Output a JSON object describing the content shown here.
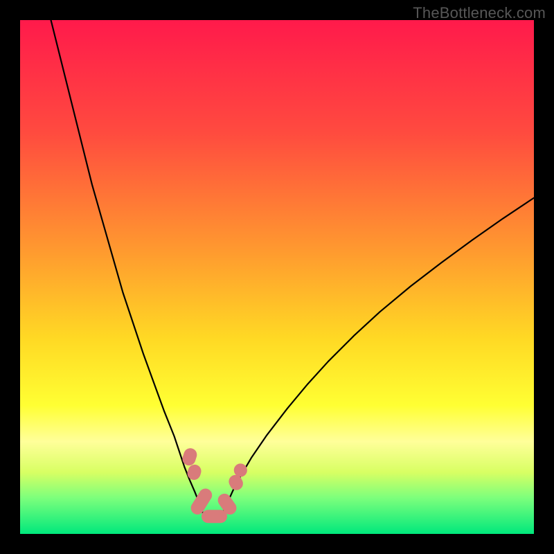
{
  "watermark": "TheBottleneck.com",
  "chart_data": {
    "type": "line",
    "title": "",
    "xlabel": "",
    "ylabel": "",
    "xlim": [
      0,
      100
    ],
    "ylim": [
      0,
      100
    ],
    "gradient_stops": [
      {
        "offset": 0,
        "color": "#ff1a4b"
      },
      {
        "offset": 0.22,
        "color": "#ff4b3f"
      },
      {
        "offset": 0.45,
        "color": "#ff9a2f"
      },
      {
        "offset": 0.62,
        "color": "#ffd924"
      },
      {
        "offset": 0.75,
        "color": "#ffff33"
      },
      {
        "offset": 0.82,
        "color": "#ffff9a"
      },
      {
        "offset": 0.88,
        "color": "#d8ff63"
      },
      {
        "offset": 0.93,
        "color": "#7cff7c"
      },
      {
        "offset": 1.0,
        "color": "#00e87c"
      }
    ],
    "series": [
      {
        "name": "left-curve",
        "x": [
          6,
          8,
          10,
          12,
          14,
          16,
          18,
          20,
          22,
          24,
          26,
          28,
          30,
          31,
          32,
          33,
          34,
          34.8
        ],
        "values": [
          100,
          92,
          84,
          76,
          68,
          61,
          54,
          47,
          41,
          35,
          29.5,
          24,
          19,
          16,
          13,
          10.5,
          8.2,
          6.2
        ]
      },
      {
        "name": "right-curve",
        "x": [
          40.5,
          41.5,
          43,
          45,
          48,
          52,
          56,
          60,
          65,
          70,
          76,
          82,
          88,
          94,
          100
        ],
        "values": [
          6.4,
          8.6,
          11.4,
          14.8,
          19.2,
          24.4,
          29.2,
          33.6,
          38.6,
          43.2,
          48.2,
          52.8,
          57.2,
          61.4,
          65.4
        ]
      },
      {
        "name": "valley-floor",
        "x": [
          34.8,
          35.5,
          36.5,
          38,
          39.5,
          40.5
        ],
        "values": [
          6.2,
          4.2,
          3.3,
          3.3,
          4.2,
          6.4
        ]
      }
    ],
    "markers": [
      {
        "shape": "capsule",
        "cx": 33.0,
        "cy": 15.0,
        "angle": -72,
        "len": 3.4
      },
      {
        "shape": "capsule",
        "cx": 33.9,
        "cy": 12.0,
        "angle": -72,
        "len": 3.0
      },
      {
        "shape": "capsule",
        "cx": 35.3,
        "cy": 6.3,
        "angle": -58,
        "len": 5.5
      },
      {
        "shape": "capsule",
        "cx": 37.8,
        "cy": 3.4,
        "angle": 0,
        "len": 5.0
      },
      {
        "shape": "capsule",
        "cx": 40.3,
        "cy": 5.8,
        "angle": 55,
        "len": 4.4
      },
      {
        "shape": "capsule",
        "cx": 42.0,
        "cy": 10.0,
        "angle": 62,
        "len": 3.0
      },
      {
        "shape": "capsule",
        "cx": 42.9,
        "cy": 12.4,
        "angle": 62,
        "len": 2.6
      }
    ],
    "marker_color": "#d97b7b",
    "curve_color": "#000000"
  }
}
